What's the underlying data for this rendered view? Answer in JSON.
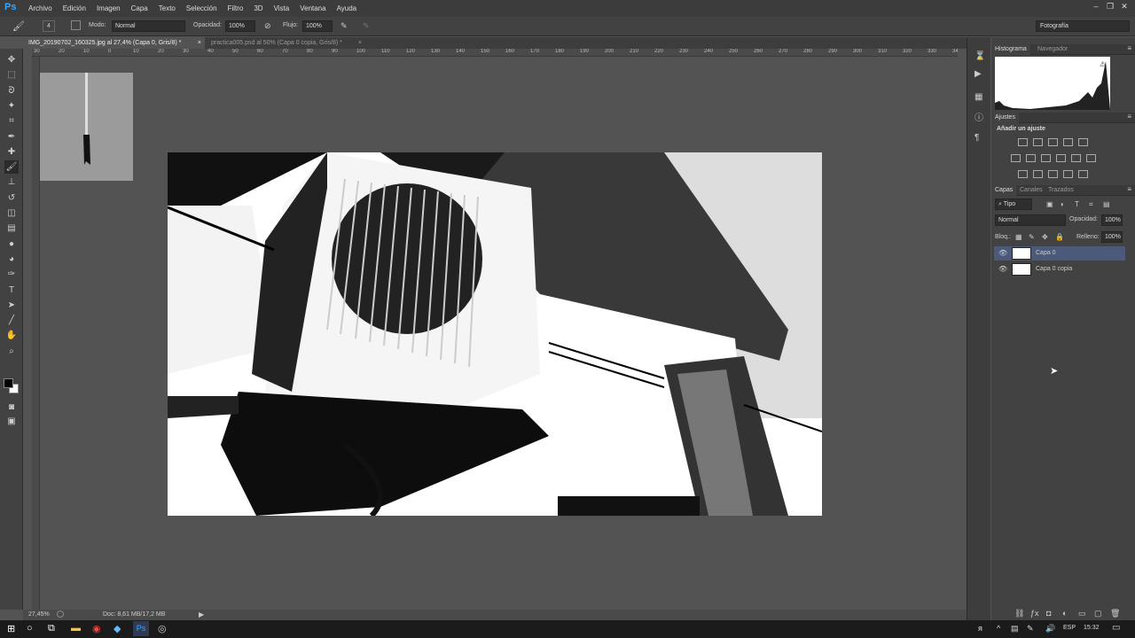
{
  "app": {
    "logo": "Ps"
  },
  "menu": [
    "Archivo",
    "Edición",
    "Imagen",
    "Capa",
    "Texto",
    "Selección",
    "Filtro",
    "3D",
    "Vista",
    "Ventana",
    "Ayuda"
  ],
  "window_controls": {
    "minimize": "–",
    "restore": "❐",
    "close": "✕"
  },
  "options": {
    "mode_label": "Modo:",
    "mode_value": "Normal",
    "opacity_label": "Opacidad:",
    "opacity_value": "100%",
    "flow_label": "Flujo:",
    "flow_value": "100%",
    "brush_size": "4"
  },
  "workspace": {
    "value": "Fotografía"
  },
  "tabs": [
    {
      "label": "IMG_20190702_160325.jpg al 27,4% (Capa 0, Gris/8) *",
      "close": "×"
    },
    {
      "label": "practica005.psd al 50% (Capa 0 copia, Gris/8) *",
      "close": "×"
    }
  ],
  "ruler_ticks": [
    "30",
    "20",
    "10",
    "0",
    "10",
    "20",
    "30",
    "40",
    "50",
    "60",
    "70",
    "80",
    "90",
    "100",
    "110",
    "120",
    "130",
    "140",
    "150",
    "160",
    "170",
    "180",
    "190",
    "200",
    "210",
    "220",
    "230",
    "240",
    "250",
    "260",
    "270",
    "280",
    "290",
    "300",
    "310",
    "320",
    "330",
    "340",
    "350",
    "360",
    "370",
    "380",
    "390",
    "400",
    "410",
    "420",
    "430",
    "440",
    "450",
    "460",
    "470",
    "480",
    "490",
    "500",
    "510",
    "520",
    "530",
    "540",
    "550",
    "560",
    "570",
    "580",
    "590",
    "600",
    "610",
    "620",
    "630",
    "640",
    "650",
    "660",
    "670",
    "680",
    "690",
    "700",
    "710",
    "720",
    "730",
    "740",
    "750",
    "760",
    "770",
    "780",
    "790",
    "800",
    "810",
    "820",
    "830",
    "840",
    "850",
    "860",
    "870",
    "880",
    "890",
    "900",
    "910",
    "920",
    "930",
    "940",
    "950",
    "960",
    "970",
    "980",
    "990",
    "1000",
    "1010",
    "1020",
    "1030",
    "1040",
    "1050",
    "1060",
    "1070",
    "1080",
    "1090",
    "1100",
    "1110",
    "1120",
    "1130",
    "1140",
    "1150",
    "1160",
    "1170",
    "1180",
    "1190",
    "1200",
    "1210",
    "1220",
    "1230",
    "1240",
    "1250",
    "1260",
    "1270",
    "1280",
    "1290",
    "1300",
    "1310",
    "1320",
    "1330",
    "1340",
    "1350",
    "1360",
    "1370",
    "1380",
    "1390",
    "1400",
    "1410",
    "1420",
    "1430",
    "1440",
    "1450",
    "1460",
    "1470",
    "1480",
    "1490",
    "1500",
    "1510",
    "1520",
    "1530",
    "1540",
    "1550",
    "1560",
    "1570",
    "1580",
    "1590",
    "1600",
    "1610",
    "1620",
    "1630",
    "1640",
    "1650",
    "1660",
    "1670",
    "1680",
    "1690",
    "1700",
    "1710",
    "1720",
    "1730",
    "1740",
    "1750",
    "1760",
    "1770",
    "1780",
    "1790",
    "1800",
    "1810",
    "1820",
    "1830",
    "1840",
    "1850",
    "1860",
    "1870",
    "1880",
    "1890",
    "1900",
    "1910",
    "1920",
    "1930",
    "1940",
    "1950",
    "1960",
    "1970",
    "1980",
    "1990",
    "2000",
    "2010",
    "2020",
    "2030",
    "2040",
    "2050",
    "2060",
    "2070",
    "2080",
    "2090",
    "2100",
    "2110",
    "2120",
    "2130",
    "2140",
    "2150",
    "2160",
    "2170",
    "2180",
    "2190",
    "2200",
    "2210",
    "2220",
    "2230",
    "2240",
    "2250",
    "2260",
    "2270",
    "2280",
    "2290",
    "2300",
    "2310",
    "2320",
    "2330",
    "2340",
    "2350",
    "2360",
    "2370",
    "2380",
    "2390",
    "2400",
    "2410",
    "2420",
    "2430",
    "2440",
    "2450",
    "2460",
    "2470",
    "2480",
    "2490",
    "2500",
    "2510",
    "2520",
    "2530",
    "2540",
    "2550",
    "2560",
    "2570",
    "2580",
    "2590",
    "2600",
    "2610",
    "2620",
    "2630",
    "2640",
    "2650",
    "2660",
    "2670",
    "2680",
    "2690",
    "2700",
    "2710",
    "2720",
    "2730",
    "2740",
    "2750",
    "2760",
    "2770",
    "2780",
    "2790",
    "2800",
    "2810",
    "2820",
    "2830",
    "2840",
    "2850",
    "2860",
    "2870",
    "2880",
    "2890",
    "2900",
    "2910",
    "2920",
    "2930",
    "2940",
    "2950",
    "2960",
    "2970",
    "2980",
    "2990",
    "3000",
    "3010",
    "3020",
    "3030",
    "3040",
    "3050",
    "3060",
    "3070",
    "3080",
    "3090",
    "3100",
    "3110",
    "3120",
    "3130",
    "3140",
    "3150",
    "3160",
    "3170",
    "3180",
    "3190",
    "3200",
    "3210",
    "3220",
    "3230",
    "3240",
    "3250",
    "3260",
    "3270",
    "3280",
    "3290",
    "3300",
    "3310",
    "3320",
    "3330",
    "3340",
    "3350",
    "3360",
    "3370",
    "3380",
    "3390",
    "3400",
    "3410",
    "3420",
    "3430",
    "3440",
    "3450",
    "3460",
    "3470",
    "3480",
    "3490",
    "3500",
    "3510",
    "3520",
    "3530",
    "3540",
    "3550",
    "3560",
    "3570",
    "3580",
    "3590",
    "3600",
    "3610",
    "3620",
    "3630",
    "3640",
    "3650",
    "3660",
    "3670",
    "3680",
    "3690",
    "3700",
    "3710",
    "3720",
    "3730",
    "3740",
    "3750",
    "3760",
    "3770",
    "3780",
    "3790",
    "3800",
    "3810",
    "3820",
    "3830",
    "3840",
    "3850",
    "3860",
    "3870",
    "3880",
    "3890",
    "3900",
    "3910",
    "3920",
    "3930",
    "3940",
    "3950",
    "3960",
    "3970",
    "3980",
    "3990",
    "4000",
    "4010",
    "4020",
    "4030",
    "4040",
    "4050",
    "4060",
    "4070",
    "4080",
    "4090",
    "4100",
    "4110",
    "4120",
    "4130",
    "4140",
    "4150",
    "4160",
    "4170",
    "4180",
    "4190",
    "4200",
    "4210",
    "4220",
    "4230",
    "4240",
    "4250",
    "4260",
    "4270",
    "4280",
    "4290",
    "4300",
    "4310",
    "4320",
    "4330",
    "4340",
    "4350",
    "4360",
    "4370",
    "4380",
    "4390",
    "4400",
    "4410",
    "4420",
    "4430",
    "4440",
    "4450",
    "4460",
    "4470",
    "4480",
    "4490",
    "4500",
    "4510",
    "4520",
    "4530",
    "4540",
    "4550",
    "4560",
    "4570",
    "4580",
    "4590",
    "4600",
    "4610",
    "4620",
    "4630",
    "4640",
    "4650",
    "4660",
    "4670",
    "4680",
    "4690",
    "4700",
    "4710",
    "4720",
    "4730",
    "4740",
    "4750",
    "4760",
    "4770",
    "4780",
    "4790",
    "4800",
    "4810",
    "4820",
    "4830",
    "4840",
    "4850",
    "4860",
    "4870",
    "4880",
    "4890",
    "4900",
    "4910",
    "4920",
    "4930",
    "4940",
    "4950",
    "4960",
    "4970",
    "4980",
    "4990",
    "5000",
    "5010",
    "5020",
    "5030",
    "5040",
    "5050",
    "5060",
    "5070",
    "5080",
    "5090",
    "5100",
    "5110",
    "5120",
    "5130",
    "5140",
    "5150",
    "5160",
    "5170",
    "5180",
    "5190",
    "5200",
    "5210",
    "5220",
    "5230",
    "5240",
    "5250",
    "5260",
    "5270",
    "5280",
    "5290",
    "5300",
    "5310",
    "5320",
    "5330",
    "5340",
    "5350",
    "5360",
    "5370",
    "5380",
    "5390",
    "5400",
    "5410",
    "5420",
    "5430",
    "5440",
    "5450",
    "5460",
    "5470",
    "5480",
    "5490",
    "5500",
    "5510",
    "5520",
    "5530",
    "5540",
    "5550",
    "5560",
    "5570",
    "5580",
    "5590",
    "5600",
    "5610",
    "5620",
    "5630",
    "5640",
    "5650",
    "5660",
    "5670",
    "5680",
    "5690",
    "5700",
    "5710",
    "5720",
    "5730",
    "5740",
    "5750",
    "5760",
    "5770",
    "5780",
    "5790",
    "5800",
    "5810",
    "5820",
    "5830",
    "5840",
    "5850",
    "5860",
    "5870",
    "5880",
    "5890",
    "5900",
    "5910",
    "5920",
    "5930",
    "5940",
    "5950",
    "5960",
    "5970",
    "5980",
    "5990",
    "6000",
    "6010",
    "6020",
    "6030",
    "6040",
    "6050",
    "6060",
    "6070",
    "6080",
    "6090",
    "6100",
    "6110",
    "6120",
    "6130",
    "6140",
    "6150",
    "6160",
    "6170",
    "6180",
    "6190",
    "6200",
    "6210",
    "6220",
    "6230",
    "6240",
    "6250",
    "6260",
    "6270",
    "6280",
    "6290",
    "6300",
    "6310",
    "6320",
    "6330",
    "6340",
    "6350",
    "6360",
    "6370",
    "6380",
    "6390",
    "6400",
    "6410",
    "6420",
    "6430",
    "6440",
    "6450",
    "6460",
    "6470",
    "6480",
    "6490",
    "6500",
    "6510",
    "6520",
    "6530",
    "6540",
    "6550",
    "6560",
    "6570",
    "6580",
    "6590",
    "6600",
    "6610",
    "6620",
    "6630",
    "6640",
    "6650",
    "6660",
    "6670",
    "6680",
    "6690",
    "6700",
    "6710",
    "6720",
    "6730",
    "6740",
    "6750",
    "6760",
    "6770",
    "6780",
    "6790",
    "6800",
    "6810",
    "6820",
    "6830",
    "6840",
    "6850",
    "6860",
    "6870",
    "6880",
    "6890",
    "6900",
    "6910",
    "6920",
    "6930",
    "6940",
    "6950",
    "6960",
    "6970",
    "6980",
    "6990",
    "7000"
  ],
  "panels": {
    "histogram_tab": "Histograma",
    "navigator_tab": "Navegador",
    "adjustments_tab": "Ajustes",
    "add_adjustment": "Añadir un ajuste",
    "layers_tab": "Capas",
    "channels_tab": "Canales",
    "paths_tab": "Trazados"
  },
  "layers_panel": {
    "filter": "Tipo",
    "blend_mode": "Normal",
    "opacity_label": "Opacidad:",
    "opacity_value": "100%",
    "lock_label": "Bloq.:",
    "fill_label": "Relleno:",
    "fill_value": "100%",
    "layers": [
      {
        "name": "Capa 0",
        "selected": true
      },
      {
        "name": "Capa 0 copia",
        "selected": false
      }
    ]
  },
  "status": {
    "zoom": "27,45%",
    "doc": "Doc: 8,61 MB/17,2 MB"
  },
  "taskbar": {
    "lang": "ESP",
    "time": "15:32"
  },
  "colors": {
    "accent": "#31a8ff",
    "selected_layer": "#4a5a78"
  }
}
